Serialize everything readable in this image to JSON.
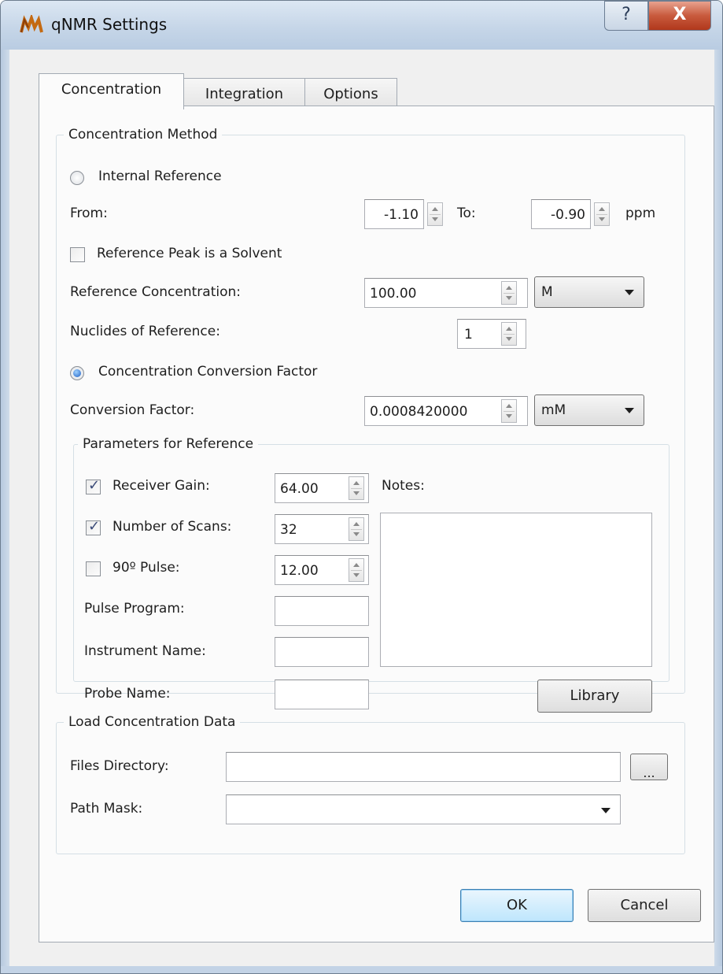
{
  "window": {
    "title": "qNMR Settings",
    "help_glyph": "?",
    "close_glyph": "X"
  },
  "tabs": [
    {
      "label": "Concentration",
      "active": true
    },
    {
      "label": "Integration",
      "active": false
    },
    {
      "label": "Options",
      "active": false
    }
  ],
  "concentration_method": {
    "group_label": "Concentration Method",
    "internal_reference": {
      "label": "Internal Reference",
      "selected": false
    },
    "from_label": "From:",
    "from_value": "-1.10",
    "to_label": "To:",
    "to_value": "-0.90",
    "unit_ppm": "ppm",
    "solvent_checkbox": {
      "label": "Reference Peak is a Solvent",
      "checked": false
    },
    "ref_conc_label": "Reference Concentration:",
    "ref_conc_value": "100.00",
    "ref_conc_unit": "M",
    "nuclides_label": "Nuclides of Reference:",
    "nuclides_value": "1",
    "conversion_factor_radio": {
      "label": "Concentration Conversion Factor",
      "selected": true
    },
    "conversion_factor_label": "Conversion Factor:",
    "conversion_factor_value": "0.0008420000",
    "conversion_factor_unit": "mM"
  },
  "parameters": {
    "group_label": "Parameters for Reference",
    "receiver_gain": {
      "label": "Receiver Gain:",
      "checked": true,
      "value": "64.00"
    },
    "num_scans": {
      "label": "Number of Scans:",
      "checked": true,
      "value": "32"
    },
    "pulse90": {
      "label": "90º Pulse:",
      "checked": false,
      "value": "12.00"
    },
    "pulse_program_label": "Pulse Program:",
    "pulse_program_value": "",
    "instrument_label": "Instrument Name:",
    "instrument_value": "",
    "probe_label": "Probe Name:",
    "probe_value": "",
    "notes_label": "Notes:",
    "notes_value": "",
    "library_button": "Library"
  },
  "load_data": {
    "group_label": "Load Concentration Data",
    "files_dir_label": "Files Directory:",
    "files_dir_value": "",
    "browse_label": "...",
    "path_mask_label": "Path Mask:",
    "path_mask_value": ""
  },
  "buttons": {
    "ok": "OK",
    "cancel": "Cancel"
  },
  "colors": {
    "selected_radio": "#1d5fc4",
    "close_button": "#c85a3d",
    "default_button": "#bee6fd"
  }
}
